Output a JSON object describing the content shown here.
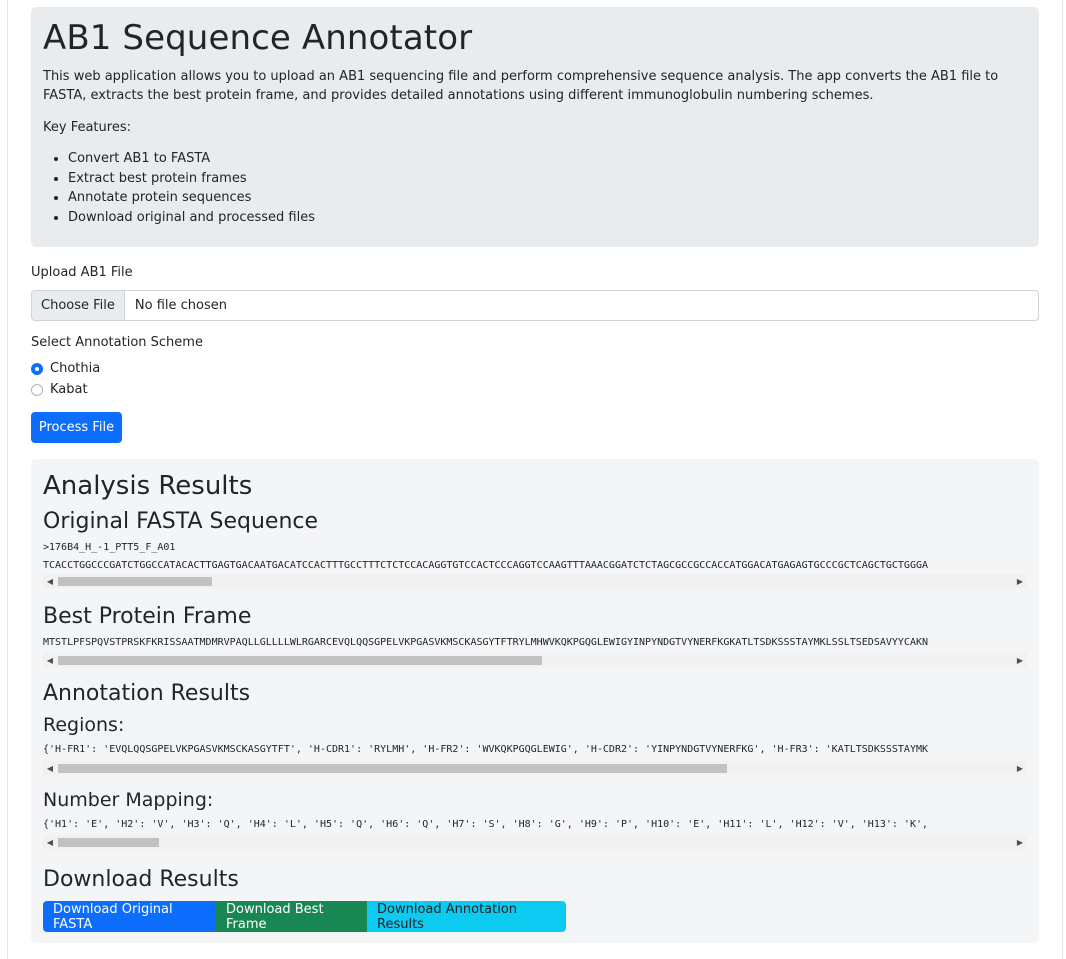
{
  "header": {
    "title": "AB1 Sequence Annotator",
    "description": "This web application allows you to upload an AB1 sequencing file and perform comprehensive sequence analysis. The app converts the AB1 file to FASTA, extracts the best protein frame, and provides detailed annotations using different immunoglobulin numbering schemes.",
    "features_label": "Key Features:",
    "features": [
      "Convert AB1 to FASTA",
      "Extract best protein frames",
      "Annotate protein sequences",
      "Download original and processed files"
    ]
  },
  "upload": {
    "label": "Upload AB1 File",
    "button": "Choose File",
    "status": "No file chosen"
  },
  "scheme": {
    "label": "Select Annotation Scheme",
    "options": [
      "Chothia",
      "Kabat"
    ],
    "selected": "Chothia"
  },
  "process_button": "Process File",
  "results": {
    "title": "Analysis Results",
    "fasta_heading": "Original FASTA Sequence",
    "fasta_header": ">176B4_H_-1_PTT5_F_A01",
    "fasta_sequence": "TCACCTGGCCCGATCTGGCCATACACTTGAGTGACAATGACATCCACTTTGCCTTTCTCTCCACAGGTGTCCACTCCCAGGTCCAAGTTTAAACGGATCTCTAGCGCCGCCACCATGGACATGAGAGTGCCCGCTCAGCTGCTGGGA",
    "frame_heading": "Best Protein Frame",
    "frame_sequence": "MTSTLPFSPQVSTPRSKFKRISSAATMDMRVPAQLLGLLLLWLRGARCEVQLQQSGPELVKPGASVKMSCKASGYTFTRYLMHWVKQKPGQGLEWIGYINPYNDGTVYNERFKGKATLTSDKSSSTAYMKLSSLTSEDSAVYYCAKN",
    "annotation_heading": "Annotation Results",
    "regions_heading": "Regions:",
    "regions_text": "{'H-FR1': 'EVQLQQSGPELVKPGASVKMSCKASGYTFT', 'H-CDR1': 'RYLMH', 'H-FR2': 'WVKQKPGQGLEWIG', 'H-CDR2': 'YINPYNDGTVYNERFKG', 'H-FR3': 'KATLTSDKSSSTAYMK",
    "mapping_heading": "Number Mapping:",
    "mapping_text": "{'H1': 'E', 'H2': 'V', 'H3': 'Q', 'H4': 'L', 'H5': 'Q', 'H6': 'Q', 'H7': 'S', 'H8': 'G', 'H9': 'P', 'H10': 'E', 'H11': 'L', 'H12': 'V', 'H13': 'K',",
    "download_heading": "Download Results",
    "downloads": [
      "Download Original FASTA",
      "Download Best Frame",
      "Download Annotation Results"
    ]
  },
  "colors": {
    "primary": "#0d6efd",
    "success": "#198754",
    "info": "#0dcaf0"
  }
}
